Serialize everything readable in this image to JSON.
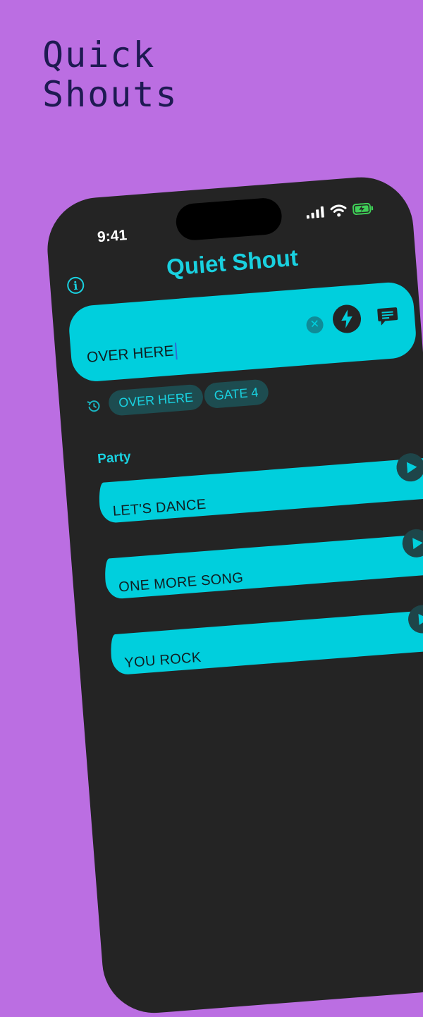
{
  "promo": {
    "line1": "Quick",
    "line2": "Shouts"
  },
  "status_bar": {
    "time": "9:41"
  },
  "app": {
    "title": "Quiet Shout"
  },
  "input": {
    "value": "OVER HERE"
  },
  "history": {
    "chips": [
      "OVER HERE",
      "GATE 4"
    ]
  },
  "section": {
    "title": "Party"
  },
  "shouts": [
    {
      "label": "LET'S DANCE"
    },
    {
      "label": "ONE MORE SONG"
    },
    {
      "label": "YOU ROCK"
    }
  ],
  "colors": {
    "background": "#bb6ee2",
    "phone": "#242424",
    "accent": "#00cfdd",
    "headline": "#1e1a52"
  }
}
